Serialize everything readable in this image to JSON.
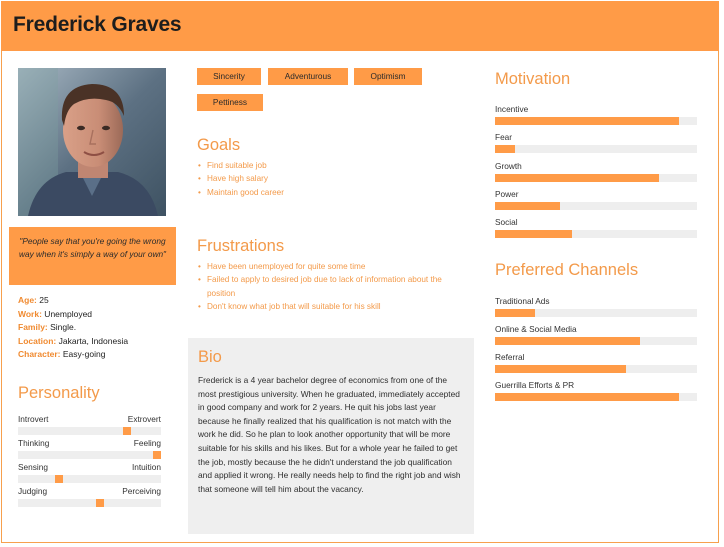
{
  "persona": {
    "name": "Frederick Graves",
    "quote": "\"People say that you're going the wrong way when it's simply a way of your own\""
  },
  "facts": [
    {
      "key": "Age:",
      "value": " 25"
    },
    {
      "key": "Work:",
      "value": " Unemployed"
    },
    {
      "key": "Family:",
      "value": " Single."
    },
    {
      "key": "Location:",
      "value": " Jakarta, Indonesia"
    },
    {
      "key": "Character:",
      "value": " Easy-going"
    }
  ],
  "personality": {
    "title": "Personality",
    "scales": [
      {
        "left": "Introvert",
        "right": "Extrovert",
        "level": 0.76
      },
      {
        "left": "Thinking",
        "right": "Feeling",
        "level": 0.97
      },
      {
        "left": "Sensing",
        "right": "Intuition",
        "level": 0.29
      },
      {
        "left": "Judging",
        "right": "Perceiving",
        "level": 0.57
      }
    ]
  },
  "tags": [
    "Sincerity",
    "Adventurous",
    "Optimism",
    "Pettiness"
  ],
  "goals": {
    "title": "Goals",
    "items": [
      "Find suitable job",
      "Have high salary",
      "Maintain good career"
    ]
  },
  "frustrations": {
    "title": "Frustrations",
    "items": [
      "Have been unemployed for quite some time",
      "Failed to apply to desired job due to lack of information about the position",
      "Don't know what job that will suitable for his skill"
    ]
  },
  "bio": {
    "title": "Bio",
    "text": "Frederick is a 4 year bachelor degree of economics from one of the most prestigious university. When he graduated, immediately accepted in good company and work for 2 years. He quit his jobs last year because he finally realized that his qualification is not match with the work he did. So he plan to look another opportunity that will be more suitable for his skills and his likes. But for a whole year he failed to get the job, mostly because the he didn't understand the job qualification and applied it wrong. He really needs help to find the right job and wish that someone will tell him about the vacancy."
  },
  "motivation": {
    "title": "Motivation",
    "items": [
      {
        "label": "Incentive",
        "level": 0.91
      },
      {
        "label": "Fear",
        "level": 0.1
      },
      {
        "label": "Growth",
        "level": 0.81
      },
      {
        "label": "Power",
        "level": 0.32
      },
      {
        "label": "Social",
        "level": 0.38
      }
    ]
  },
  "channels": {
    "title": "Preferred Channels",
    "items": [
      {
        "label": "Traditional Ads",
        "level": 0.2
      },
      {
        "label": "Online & Social Media",
        "level": 0.72
      },
      {
        "label": "Referral",
        "level": 0.65
      },
      {
        "label": "Guerrilla Efforts & PR",
        "level": 0.91
      }
    ]
  },
  "colors": {
    "accent": "#ff9b47",
    "track": "#eeeeee",
    "heading": "#f39a4a"
  }
}
